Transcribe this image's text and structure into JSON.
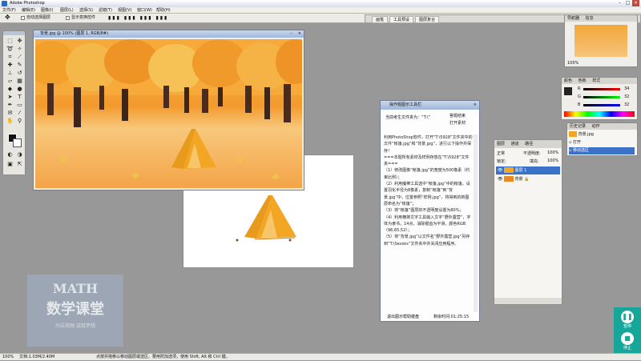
{
  "window": {
    "title": "Adobe Photoshop"
  },
  "menu": [
    "文件(F)",
    "编辑(E)",
    "图像(I)",
    "图层(L)",
    "选择(S)",
    "滤镜(T)",
    "视图(V)",
    "窗口(W)",
    "帮助(H)"
  ],
  "options": {
    "auto_select": "自动选择图层",
    "show_transform": "显示变换控件"
  },
  "palette_well_tabs": [
    "画笔",
    "工具预设",
    "图层复合"
  ],
  "doc_background": {
    "title": "背景.jpg @ 100% (图层 1, RGB/8#)"
  },
  "action_panel": {
    "title": "操作题图示工具栏",
    "folder_label": "当前考生文件夹为：“T:\\”",
    "side_btn1": "答题结束",
    "side_btn2": "打开素材",
    "body": "利用PhotoShop软件，打开“T:\\5928”文件夹中的文件“帐篷.jpg”和“背景.jpg”，进行以下操作并保存！\n===本题所有素材及样例存放在“T:\\5928”文件夹===\n（1）修改图像“帐篷.jpg”的宽度为500像素（约束比例）；\n（2）利用魔棒工具选中“帐篷.jpg”中的帐篷，设置羽化半径为8像素，复制“帐篷”到“背景.jpg”中，位置参照“样例.jpg”，将得到的新图层命名为“帐篷”；\n（3）将“帐篷”图层的不透明度设置为80%；\n（4）利用横排文字工具输入文字“野外露营”，字体为隶书，14点，消除锯齿为平滑，颜色RGB（96,65,52）；\n（5）将“背景.jpg”以文件名“野外露营.jpg”另存到“T:\\Sevsks”文件夹中并关闭应用程序。",
    "footer_left": "退出图示帮助键盘",
    "footer_right": "剩余时间:01:25:15"
  },
  "layers": {
    "tabs": [
      "图层",
      "通道",
      "路径"
    ],
    "mode": "正常",
    "opacity_label": "不透明度:",
    "opacity": "100%",
    "lock_label": "锁定:",
    "fill_label": "填充:",
    "fill": "100%",
    "items": [
      "图层 1",
      "背景"
    ]
  },
  "history": {
    "tabs": [
      "历史记录",
      "动作"
    ],
    "items": [
      "背景.jpg",
      "打开",
      "移动选区"
    ]
  },
  "color_panel": {
    "tabs": [
      "颜色",
      "色板",
      "样式"
    ],
    "rows": [
      [
        "R",
        "34"
      ],
      [
        "G",
        "32"
      ],
      [
        "B",
        "32"
      ]
    ]
  },
  "navigator": {
    "tabs": [
      "导航器",
      "信息"
    ],
    "zoom": "100%"
  },
  "status": {
    "zoom": "100%",
    "doc": "文档:1.03M/2.40M",
    "hint": "点按并拖移以移动图层或选区。要用附加选项，使用 Shift, Alt 和 Ctrl 键。"
  },
  "watermark": {
    "line1": "MATH",
    "line2": "数学课堂",
    "line3": "开启视频  成就梦想"
  },
  "sidebar": {
    "btn1": "暂停",
    "btn2": "停止"
  },
  "colors": {
    "accent": "#16a79a",
    "tent": "#f2a623"
  }
}
